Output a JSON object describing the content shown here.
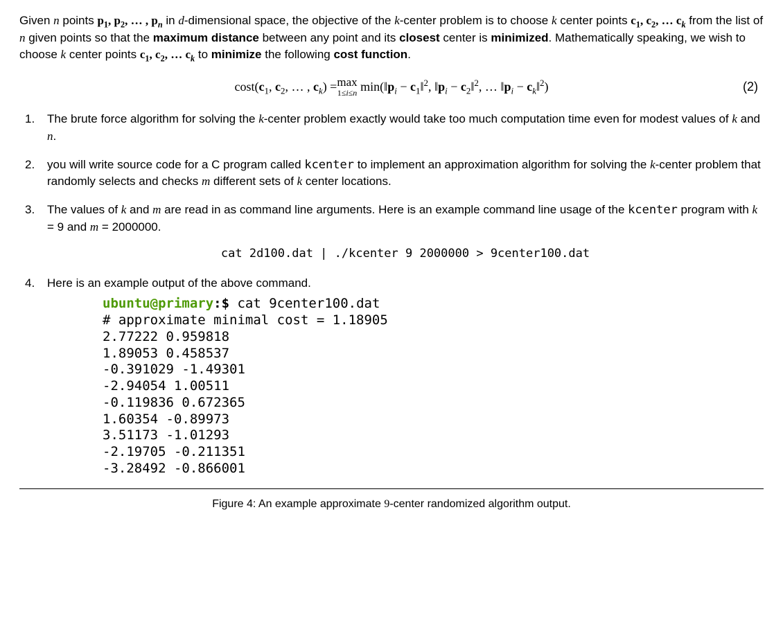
{
  "intro": {
    "p1a": "Given ",
    "n": "n",
    "p1b": " points ",
    "plist": "p₁, p₂, … , pₙ",
    "p1c": " in ",
    "d": "d",
    "p1d": "-dimensional space, the objective of the ",
    "k": "k",
    "p1e": "-center problem is to choose ",
    "k2": "k",
    "p1f": " center points ",
    "clist": "c₁, c₂, … cₖ",
    "p1g": " from the list of ",
    "n2": "n",
    "p1h": " given points so that the ",
    "maxdist": "maximum distance",
    "p1i": " between any point and its ",
    "closest": "closest",
    "p1j": " center is ",
    "minimized": "minimized",
    "p1k": ".  Mathematically speaking, we wish to choose ",
    "k3": "k",
    "p1l": " center points ",
    "clist2": "c₁, c₂, … cₖ",
    "p1m": " to ",
    "minimize": "minimize",
    "p1n": " the following ",
    "costfn": "cost function",
    "p1o": "."
  },
  "equation": {
    "lhs_cost": "cost",
    "lhs_args": "(c₁, c₂, … , cₖ) = ",
    "max": "max",
    "max_sub": "1≤i≤n",
    "min": "min",
    "body": "(‖pᵢ − c₁‖², ‖pᵢ − c₂‖², … ‖pᵢ − cₖ‖²)",
    "number": "(2)"
  },
  "items": {
    "i1a": "The brute force algorithm for solving the ",
    "i1k": "k",
    "i1b": "-center problem exactly would take too much computation time even for modest values of ",
    "i1k2": "k",
    "i1c": " and ",
    "i1n": "n",
    "i1d": ".",
    "i2a": "you will write source code for a C program called ",
    "i2prog": "kcenter",
    "i2b": " to implement an approximation algorithm for solving the ",
    "i2k": "k",
    "i2c": "-center problem that randomly selects and checks ",
    "i2m": "m",
    "i2d": " different sets of ",
    "i2k2": "k",
    "i2e": " center locations.",
    "i3a": "The values of ",
    "i3k": "k",
    "i3b": " and ",
    "i3m": "m",
    "i3c": " are read in as command line arguments. Here is an example command line usage of the ",
    "i3prog": "kcenter",
    "i3d": " program with ",
    "i3k2": "k",
    "i3e": " = 9 and ",
    "i3m2": "m",
    "i3f": " = 2000000.",
    "i4": "Here is an example output of the above command."
  },
  "command": "cat 2d100.dat | ./kcenter 9 2000000 > 9center100.dat",
  "terminal": {
    "prompt_user": "ubuntu@primary",
    "prompt_rest": ":$ ",
    "cmd": "cat 9center100.dat",
    "lines": [
      "# approximate minimal cost = 1.18905",
      "2.77222 0.959818",
      "1.89053 0.458537",
      "-0.391029 -1.49301",
      "-2.94054 1.00511",
      "-0.119836 0.672365",
      "1.60354 -0.89973",
      "3.51173 -1.01293",
      "-2.19705 -0.211351",
      "-3.28492 -0.866001"
    ]
  },
  "caption": {
    "figlabel": "Figure 4:",
    "a": " An example approximate ",
    "nine": "9",
    "b": "-center randomized algorithm output."
  }
}
